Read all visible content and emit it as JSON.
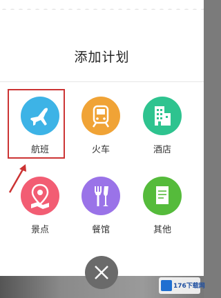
{
  "dialog": {
    "title": "添加计划"
  },
  "options": [
    {
      "label": "航班",
      "icon": "airplane-icon",
      "color": "#3db3e6"
    },
    {
      "label": "火车",
      "icon": "train-icon",
      "color": "#f0a336"
    },
    {
      "label": "酒店",
      "icon": "hotel-building-icon",
      "color": "#2ec38f"
    },
    {
      "label": "景点",
      "icon": "attraction-map-pin-icon",
      "color": "#f25d73"
    },
    {
      "label": "餐馆",
      "icon": "restaurant-cutlery-icon",
      "color": "#9a73e8"
    },
    {
      "label": "其他",
      "icon": "other-document-icon",
      "color": "#55bb3b"
    }
  ],
  "close_button": {
    "icon": "close-icon"
  },
  "watermark": {
    "text": "176下载网"
  },
  "colors": {
    "highlight": "#cc3333",
    "close_button_bg": "#6a6a6a"
  }
}
